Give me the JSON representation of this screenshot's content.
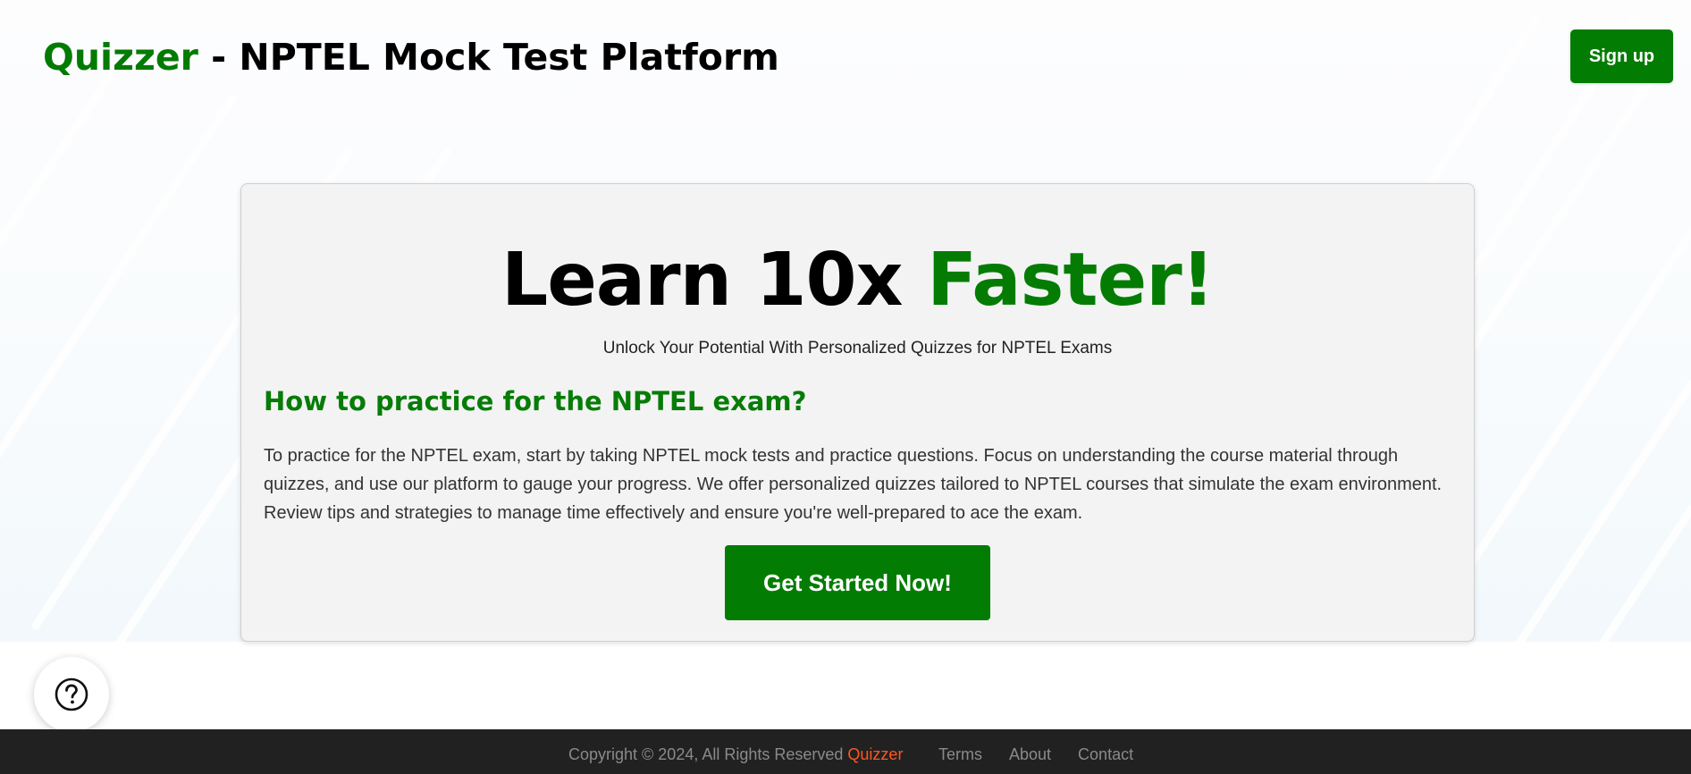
{
  "header": {
    "brand": "Quizzer",
    "title_rest": " - NPTEL Mock Test Platform",
    "signup_label": "Sign up",
    "brand_color": "#037b03"
  },
  "hero": {
    "heading_part1": "Learn 10x ",
    "heading_accent": "Faster!",
    "subtitle": "Unlock Your Potential With Personalized Quizzes for NPTEL Exams",
    "how_title": "How to practice for the NPTEL exam?",
    "how_body": "To practice for the NPTEL exam, start by taking NPTEL mock tests and practice questions. Focus on understanding the course material through quizzes, and use our platform to gauge your progress. We offer personalized quizzes tailored to NPTEL courses that simulate the exam environment. Review tips and strategies to manage time effectively and ensure you're well-prepared to ace the exam.",
    "cta_label": "Get Started Now!"
  },
  "help": {
    "icon": "question-circle-icon"
  },
  "footer": {
    "copyright": "Copyright © 2024, All Rights Reserved ",
    "brand": "Quizzer",
    "brand_color": "#ff5722",
    "links": [
      {
        "label": "Terms"
      },
      {
        "label": "About"
      },
      {
        "label": "Contact"
      }
    ]
  }
}
